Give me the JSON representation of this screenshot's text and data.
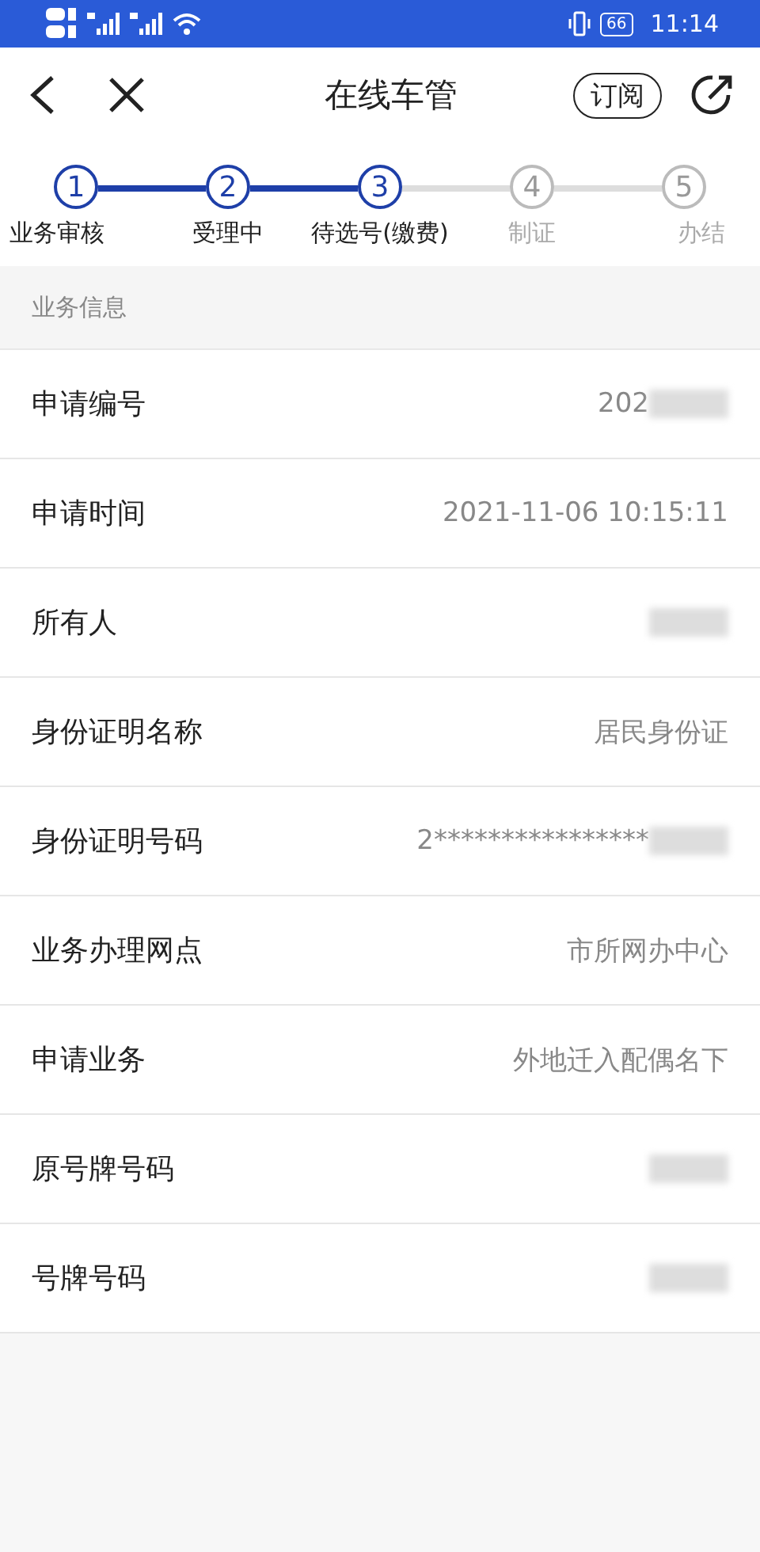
{
  "status_bar": {
    "battery": "66",
    "time": "11:14"
  },
  "header": {
    "title": "在线车管",
    "subscribe": "订阅"
  },
  "steps": [
    {
      "number": "1",
      "label": "业务审核",
      "done": true
    },
    {
      "number": "2",
      "label": "受理中",
      "done": true
    },
    {
      "number": "3",
      "label": "待选号(缴费)",
      "done": true
    },
    {
      "number": "4",
      "label": "制证",
      "done": false
    },
    {
      "number": "5",
      "label": "办结",
      "done": false
    }
  ],
  "section": {
    "title": "业务信息"
  },
  "rows": [
    {
      "label": "申请编号",
      "value": "202",
      "redacted": true
    },
    {
      "label": "申请时间",
      "value": "2021-11-06 10:15:11"
    },
    {
      "label": "所有人",
      "redacted": true
    },
    {
      "label": "身份证明名称",
      "value": "居民身份证"
    },
    {
      "label": "身份证明号码",
      "value": "2****************",
      "redacted": true
    },
    {
      "label": "业务办理网点",
      "value": "市所网办中心"
    },
    {
      "label": "申请业务",
      "value": "外地迁入配偶名下"
    },
    {
      "label": "原号牌号码",
      "redacted": true
    },
    {
      "label": "号牌号码",
      "redacted": true
    }
  ]
}
